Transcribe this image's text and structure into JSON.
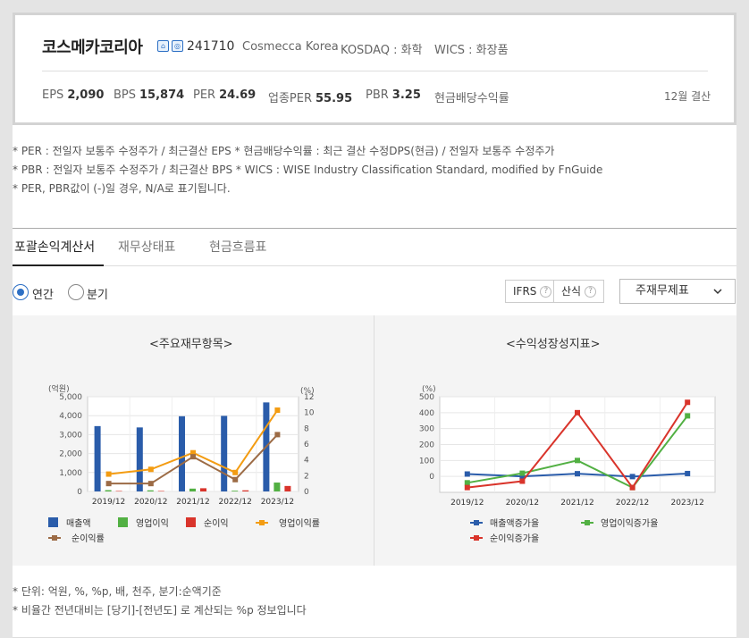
{
  "company": {
    "name": "코스메카코리아",
    "icons": [
      "home-icon",
      "report-icon"
    ],
    "code": "241710",
    "name_en": "Cosmecca Korea",
    "market": "KOSDAQ : 화학",
    "wics": "WICS : 화장품"
  },
  "metrics": [
    {
      "label": "EPS",
      "value": "2,090"
    },
    {
      "label": "BPS",
      "value": "15,874"
    },
    {
      "label": "PER",
      "value": "24.69"
    },
    {
      "label": "업종PER",
      "value": "55.95"
    },
    {
      "label": "PBR",
      "value": "3.25"
    },
    {
      "label": "현금배당수익률",
      "value": ""
    }
  ],
  "settlement": "12월 결산",
  "notes": [
    "* PER : 전일자 보통주 수정주가 / 최근결산 EPS * 현금배당수익률 : 최근 결산 수정DPS(현금) / 전일자 보통주 수정주가",
    "* PBR : 전일자 보통주 수정주가 / 최근결산 BPS * WICS : WISE Industry Classification Standard, modified by FnGuide",
    "* PER, PBR값이 (-)일 경우, N/A로 표기됩니다."
  ],
  "tabs": [
    {
      "label": "포괄손익계산서",
      "active": true
    },
    {
      "label": "재무상태표",
      "active": false
    },
    {
      "label": "현금흐름표",
      "active": false
    }
  ],
  "period": {
    "annual": "연간",
    "quarter": "분기",
    "selected": "annual"
  },
  "controls": {
    "ifrs": "IFRS",
    "calc": "산식",
    "help": "?",
    "dropdown": "주재무제표"
  },
  "colors": {
    "revenue": "#2a5caa",
    "op_income": "#52b043",
    "net_income": "#d9342b",
    "op_margin": "#f39c12",
    "net_margin": "#9c6b45",
    "accent": "#2c6fc4"
  },
  "chart_data": [
    {
      "type": "bar",
      "title": "<주요재무항목>",
      "ylabel": "(억원)",
      "y2label": "(%)",
      "categories": [
        "2019/12",
        "2020/12",
        "2021/12",
        "2022/12",
        "2023/12"
      ],
      "ylim": [
        0,
        5000
      ],
      "y2lim": [
        0,
        12
      ],
      "yticks": [
        "0",
        "1,000",
        "2,000",
        "3,000",
        "4,000",
        "5,000"
      ],
      "y2ticks": [
        "0",
        "2",
        "4",
        "6",
        "8",
        "10",
        "12"
      ],
      "series": [
        {
          "name": "매출액",
          "kind": "bar",
          "axis": "left",
          "values": [
            3450,
            3380,
            3970,
            3990,
            4700
          ]
        },
        {
          "name": "영업이익",
          "kind": "bar",
          "axis": "left",
          "values": [
            70,
            60,
            150,
            40,
            470
          ]
        },
        {
          "name": "순이익",
          "kind": "bar",
          "axis": "left",
          "values": [
            25,
            25,
            170,
            60,
            290
          ]
        },
        {
          "name": "영업이익률",
          "kind": "line",
          "axis": "right",
          "values": [
            2.2,
            2.8,
            4.9,
            2.4,
            10.3
          ]
        },
        {
          "name": "순이익률",
          "kind": "line",
          "axis": "right",
          "values": [
            1.0,
            1.0,
            4.4,
            1.5,
            7.2
          ]
        }
      ],
      "grid": true,
      "legend": "bottom"
    },
    {
      "type": "line",
      "title": "<수익성장성지표>",
      "ylabel": "(%)",
      "categories": [
        "2019/12",
        "2020/12",
        "2021/12",
        "2022/12",
        "2023/12"
      ],
      "ylim": [
        -100,
        500
      ],
      "yticks": [
        "0",
        "100",
        "200",
        "300",
        "400",
        "500"
      ],
      "series": [
        {
          "name": "매출액증가율",
          "values": [
            15,
            0,
            17,
            -1,
            18
          ]
        },
        {
          "name": "영업이익증가율",
          "values": [
            -40,
            20,
            100,
            -70,
            380
          ]
        },
        {
          "name": "순이익증가율",
          "values": [
            -70,
            -30,
            400,
            -70,
            465
          ]
        }
      ],
      "grid": true,
      "legend": "bottom"
    }
  ],
  "footnotes": [
    "* 단위: 억원, %, %p, 배, 천주, 분기:순액기준",
    "* 비율간 전년대비는 [당기]-[전년도] 로 계산되는 %p 정보입니다"
  ]
}
